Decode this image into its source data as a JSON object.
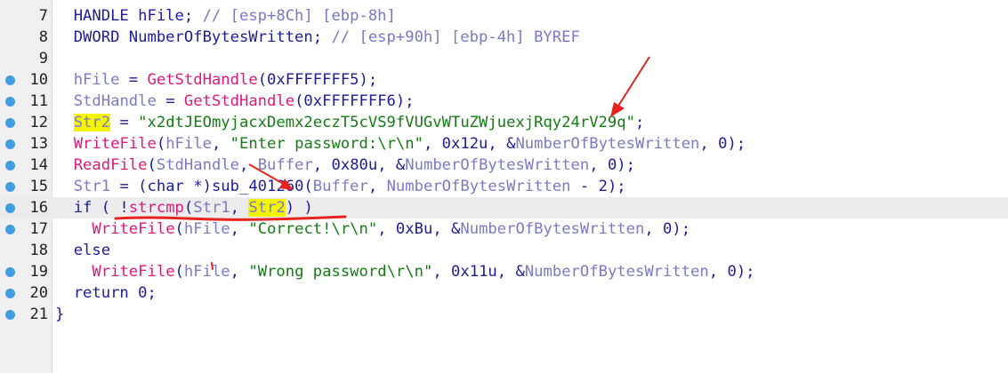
{
  "editor": {
    "lines": [
      {
        "number": "7",
        "breakpoint": false,
        "tokens": [
          {
            "text": "  HANDLE hFile; ",
            "type": "plain"
          },
          {
            "text": "// [esp+8Ch] [ebp-8h]",
            "type": "comment"
          }
        ]
      },
      {
        "number": "8",
        "breakpoint": false,
        "tokens": [
          {
            "text": "  DWORD NumberOfBytesWritten; ",
            "type": "plain"
          },
          {
            "text": "// [esp+90h] [ebp-4h] BYREF",
            "type": "comment"
          }
        ]
      },
      {
        "number": "9",
        "breakpoint": false,
        "tokens": []
      },
      {
        "number": "10",
        "breakpoint": true,
        "tokens": [
          {
            "text": "  ",
            "type": "plain"
          },
          {
            "text": "hFile",
            "type": "var"
          },
          {
            "text": " = ",
            "type": "plain"
          },
          {
            "text": "GetStdHandle",
            "type": "func"
          },
          {
            "text": "(0xFFFFFFF5);",
            "type": "plain"
          }
        ]
      },
      {
        "number": "11",
        "breakpoint": true,
        "tokens": [
          {
            "text": "  ",
            "type": "plain"
          },
          {
            "text": "StdHandle",
            "type": "var"
          },
          {
            "text": " = ",
            "type": "plain"
          },
          {
            "text": "GetStdHandle",
            "type": "func"
          },
          {
            "text": "(0xFFFFFFF6);",
            "type": "plain"
          }
        ]
      },
      {
        "number": "12",
        "breakpoint": true,
        "tokens": [
          {
            "text": "  ",
            "type": "plain"
          },
          {
            "text": "Str2",
            "type": "var",
            "highlight": true
          },
          {
            "text": " = ",
            "type": "plain"
          },
          {
            "text": "\"x2dtJEOmyjacxDemx2eczT5cVS9fVUGvWTuZWjuexjRqy24rV29q\"",
            "type": "str"
          },
          {
            "text": ";",
            "type": "plain"
          }
        ]
      },
      {
        "number": "13",
        "breakpoint": true,
        "tokens": [
          {
            "text": "  ",
            "type": "plain"
          },
          {
            "text": "WriteFile",
            "type": "func"
          },
          {
            "text": "(",
            "type": "plain"
          },
          {
            "text": "hFile",
            "type": "var"
          },
          {
            "text": ", ",
            "type": "plain"
          },
          {
            "text": "\"Enter password:\\r\\n\"",
            "type": "str"
          },
          {
            "text": ", 0x12u, &",
            "type": "plain"
          },
          {
            "text": "NumberOfBytesWritten",
            "type": "var"
          },
          {
            "text": ", 0);",
            "type": "plain"
          }
        ]
      },
      {
        "number": "14",
        "breakpoint": true,
        "tokens": [
          {
            "text": "  ",
            "type": "plain"
          },
          {
            "text": "ReadFile",
            "type": "func"
          },
          {
            "text": "(",
            "type": "plain"
          },
          {
            "text": "StdHandle",
            "type": "var"
          },
          {
            "text": ", ",
            "type": "plain"
          },
          {
            "text": "Buffer",
            "type": "var"
          },
          {
            "text": ", 0x80u, &",
            "type": "plain"
          },
          {
            "text": "NumberOfBytesWritten",
            "type": "var"
          },
          {
            "text": ", 0);",
            "type": "plain"
          }
        ]
      },
      {
        "number": "15",
        "breakpoint": true,
        "tokens": [
          {
            "text": "  ",
            "type": "plain"
          },
          {
            "text": "Str1",
            "type": "var"
          },
          {
            "text": " = (char *)",
            "type": "plain"
          },
          {
            "text": "sub_401260",
            "type": "plain"
          },
          {
            "text": "(",
            "type": "plain"
          },
          {
            "text": "Buffer",
            "type": "var"
          },
          {
            "text": ", ",
            "type": "plain"
          },
          {
            "text": "NumberOfBytesWritten",
            "type": "var"
          },
          {
            "text": " - 2);",
            "type": "plain"
          }
        ]
      },
      {
        "number": "16",
        "breakpoint": true,
        "current": true,
        "tokens": [
          {
            "text": "  if ( !",
            "type": "plain"
          },
          {
            "text": "strcmp",
            "type": "func"
          },
          {
            "text": "(",
            "type": "plain"
          },
          {
            "text": "Str1",
            "type": "var"
          },
          {
            "text": ", ",
            "type": "plain"
          },
          {
            "text": "Str2",
            "type": "var",
            "highlight": true
          },
          {
            "text": ") )",
            "type": "plain"
          }
        ]
      },
      {
        "number": "17",
        "breakpoint": true,
        "tokens": [
          {
            "text": "    ",
            "type": "plain"
          },
          {
            "text": "WriteFile",
            "type": "func"
          },
          {
            "text": "(",
            "type": "plain"
          },
          {
            "text": "hFile",
            "type": "var"
          },
          {
            "text": ", ",
            "type": "plain"
          },
          {
            "text": "\"Correct!\\r\\n\"",
            "type": "str"
          },
          {
            "text": ", 0xBu, &",
            "type": "plain"
          },
          {
            "text": "NumberOfBytesWritten",
            "type": "var"
          },
          {
            "text": ", 0);",
            "type": "plain"
          }
        ]
      },
      {
        "number": "18",
        "breakpoint": false,
        "tokens": [
          {
            "text": "  else",
            "type": "plain"
          }
        ]
      },
      {
        "number": "19",
        "breakpoint": true,
        "tokens": [
          {
            "text": "    ",
            "type": "plain"
          },
          {
            "text": "WriteFile",
            "type": "func"
          },
          {
            "text": "(",
            "type": "plain"
          },
          {
            "text": "hFile",
            "type": "var"
          },
          {
            "text": ", ",
            "type": "plain"
          },
          {
            "text": "\"Wrong password\\r\\n\"",
            "type": "str"
          },
          {
            "text": ", 0x11u, &",
            "type": "plain"
          },
          {
            "text": "NumberOfBytesWritten",
            "type": "var"
          },
          {
            "text": ", 0);",
            "type": "plain"
          }
        ]
      },
      {
        "number": "20",
        "breakpoint": true,
        "tokens": [
          {
            "text": "  return 0;",
            "type": "plain"
          }
        ]
      },
      {
        "number": "21",
        "breakpoint": true,
        "tokens": [
          {
            "text": "}",
            "type": "plain"
          }
        ]
      }
    ]
  },
  "colors": {
    "breakpoint": "#3f9de0",
    "highlight": "#f4f400",
    "annotation_red": "#e8231f",
    "string": "#137d13",
    "function": "#e0177e",
    "variable": "#7a7ac8",
    "plain": "#1c1c9c"
  },
  "annotations": [
    {
      "kind": "arrow",
      "icon": "red-arrow-icon",
      "points_to": "Str2 string literal"
    },
    {
      "kind": "arrow",
      "icon": "red-arrow-icon",
      "points_to": "sub_401260"
    },
    {
      "kind": "underline",
      "icon": "red-underline-icon",
      "points_to": "!strcmp(Str1, Str2)"
    }
  ]
}
